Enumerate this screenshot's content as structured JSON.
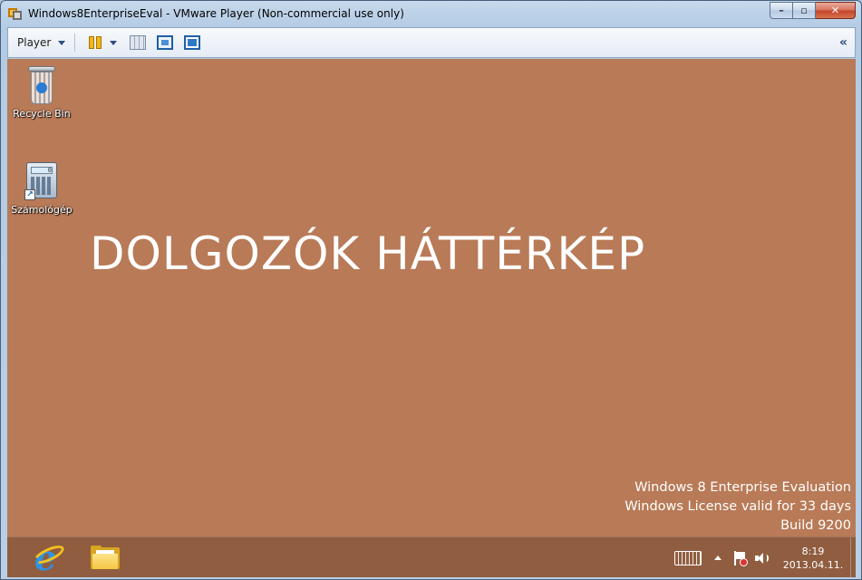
{
  "window": {
    "title": "Windows8EnterpriseEval - VMware Player (Non-commercial use only)",
    "controls": {
      "minimize": "–",
      "maximize": "▫",
      "close": "✕"
    }
  },
  "toolbar": {
    "player_label": "Player",
    "collapse_glyph": "«"
  },
  "desktop": {
    "icons": [
      {
        "label": "Recycle Bin",
        "icon": "recycle-bin-icon"
      },
      {
        "label": "Számológép",
        "icon": "calculator-icon",
        "screen_value": "0"
      }
    ],
    "wallpaper_text": "DOLGOZÓK HÁTTÉRKÉP",
    "watermark": {
      "line1": "Windows 8 Enterprise Evaluation",
      "line2": "Windows License valid for 33 days",
      "line3": "Build 9200"
    }
  },
  "taskbar": {
    "pinned": [
      {
        "name": "Internet Explorer",
        "icon": "internet-explorer-icon"
      },
      {
        "name": "File Explorer",
        "icon": "file-explorer-icon"
      }
    ],
    "clock": {
      "time": "8:19",
      "date": "2013.04.11."
    }
  },
  "colors": {
    "desktop_background": "#b87a57",
    "taskbar": "#8c5a3e"
  }
}
